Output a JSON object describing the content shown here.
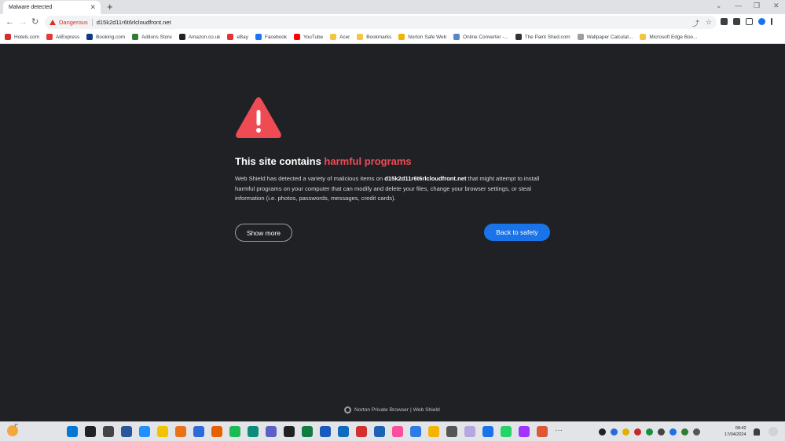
{
  "tab": {
    "title": "Malware detected",
    "close": "✕",
    "new_tab": "+"
  },
  "window": {
    "minimize": "—",
    "maximize": "❐",
    "close": "✕",
    "tab_search": "⌄"
  },
  "nav": {
    "back": "←",
    "forward": "→",
    "reload": "↻"
  },
  "omnibox": {
    "security_label": "Dangerous",
    "url": "d15k2d11r6t6rlcloudfront.net",
    "share": "⤴",
    "star": "☆"
  },
  "bookmarks": [
    {
      "label": "Hotels.com",
      "color": "#d32f2f"
    },
    {
      "label": "AliExpress",
      "color": "#e53935"
    },
    {
      "label": "Booking.com",
      "color": "#0d3b84"
    },
    {
      "label": "Addons Store",
      "color": "#2e7d32"
    },
    {
      "label": "Amazon.co.uk",
      "color": "#222222"
    },
    {
      "label": "eBay",
      "color": "#e53238"
    },
    {
      "label": "Facebook",
      "color": "#1877f2"
    },
    {
      "label": "YouTube",
      "color": "#ff0000"
    },
    {
      "label": "Acer",
      "color": "#f4c542"
    },
    {
      "label": "Bookmarks",
      "color": "#f4c542"
    },
    {
      "label": "Norton Safe Web",
      "color": "#f2b300"
    },
    {
      "label": "Online Converter -...",
      "color": "#5c85c9"
    },
    {
      "label": "The Paint Shed.com",
      "color": "#333333"
    },
    {
      "label": "Wallpaper Calculat...",
      "color": "#9e9e9e"
    },
    {
      "label": "Microsoft Edge Boo...",
      "color": "#f4c542"
    }
  ],
  "warning_page": {
    "headline_prefix": "This site contains ",
    "headline_highlight": "harmful programs",
    "desc_before": "Web Shield has detected a variety of malicious items on ",
    "desc_domain": "d15k2d11r6t6rlcloudfront.net",
    "desc_after": " that might attempt to install harmful programs on your computer that can modify and delete your files, change your browser settings, or steal information (i.e. photos, passwords, messages, credit cards).",
    "show_more": "Show more",
    "back_to_safety": "Back to safety",
    "footer": "Norton Private Browser | Web Shield",
    "accent_red": "#ef4b55",
    "accent_blue": "#1a73e8"
  },
  "taskbar": {
    "temperature": "7°",
    "time": "08:42",
    "date": "17/04/2024",
    "apps": [
      "#0078d4",
      "#202124",
      "#444444",
      "#2b579a",
      "#1e90ff",
      "#f2c300",
      "#e8711a",
      "#2b6cd8",
      "#e66000",
      "#1db954",
      "#0c8b7a",
      "#5b5fc7",
      "#222222",
      "#107c41",
      "#185abd",
      "#0f6cbd",
      "#d32f2f",
      "#1d62b7",
      "#fa4f9c",
      "#2d7be5",
      "#f4b400",
      "#555555",
      "#b5a7e0",
      "#1a73e8",
      "#25d366",
      "#a033ff",
      "#de5833"
    ],
    "tray": [
      "#202124",
      "#2a6ad8",
      "#e0b000",
      "#c62828",
      "#1b8e3e",
      "#444444",
      "#1a73e8",
      "#2e7d32",
      "#555555"
    ]
  }
}
